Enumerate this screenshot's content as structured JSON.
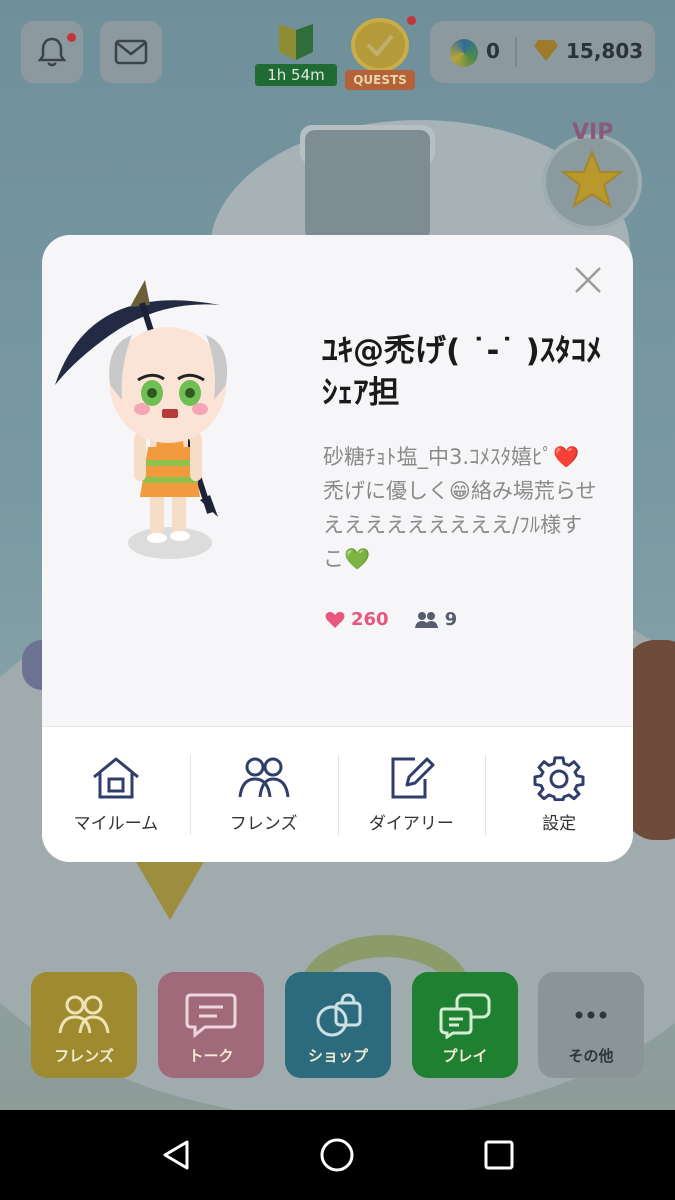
{
  "topbar": {
    "beginner_timer": "1h 54m",
    "quests_label": "QUESTS",
    "coins": "0",
    "gems": "15,803",
    "vip_label": "VIP"
  },
  "profile": {
    "name": "ﾕｷ@禿げ( ˙-˙ )ｽﾀｺﾒｼｪｱ担",
    "bio": "砂糖ﾁｮﾄ塩_中3.ｺﾒｽﾀ嬉ﾋﾟ❤️禿げに優しく😁絡み場荒らせえええええええええ/ﾌﾙ様すこ💚",
    "likes": "260",
    "friends": "9",
    "actions": [
      {
        "label": "マイルーム",
        "icon": "home-icon"
      },
      {
        "label": "フレンズ",
        "icon": "friends-icon"
      },
      {
        "label": "ダイアリー",
        "icon": "diary-edit-icon"
      },
      {
        "label": "設定",
        "icon": "gear-icon"
      }
    ]
  },
  "bottom_nav": [
    {
      "label": "フレンズ",
      "icon": "friends-icon"
    },
    {
      "label": "トーク",
      "icon": "chat-icon"
    },
    {
      "label": "ショップ",
      "icon": "shop-bag-icon"
    },
    {
      "label": "プレイ",
      "icon": "gamepad-icon"
    },
    {
      "label": "その他",
      "icon": "more-icon"
    }
  ],
  "colors": {
    "modal_bg": "#f6f6f8",
    "like_pink": "#e8557e",
    "friends_nav": "#9e8a2f",
    "talk_nav": "#a06a7a",
    "shop_nav": "#2b6b7d",
    "play_nav": "#1e8030"
  }
}
